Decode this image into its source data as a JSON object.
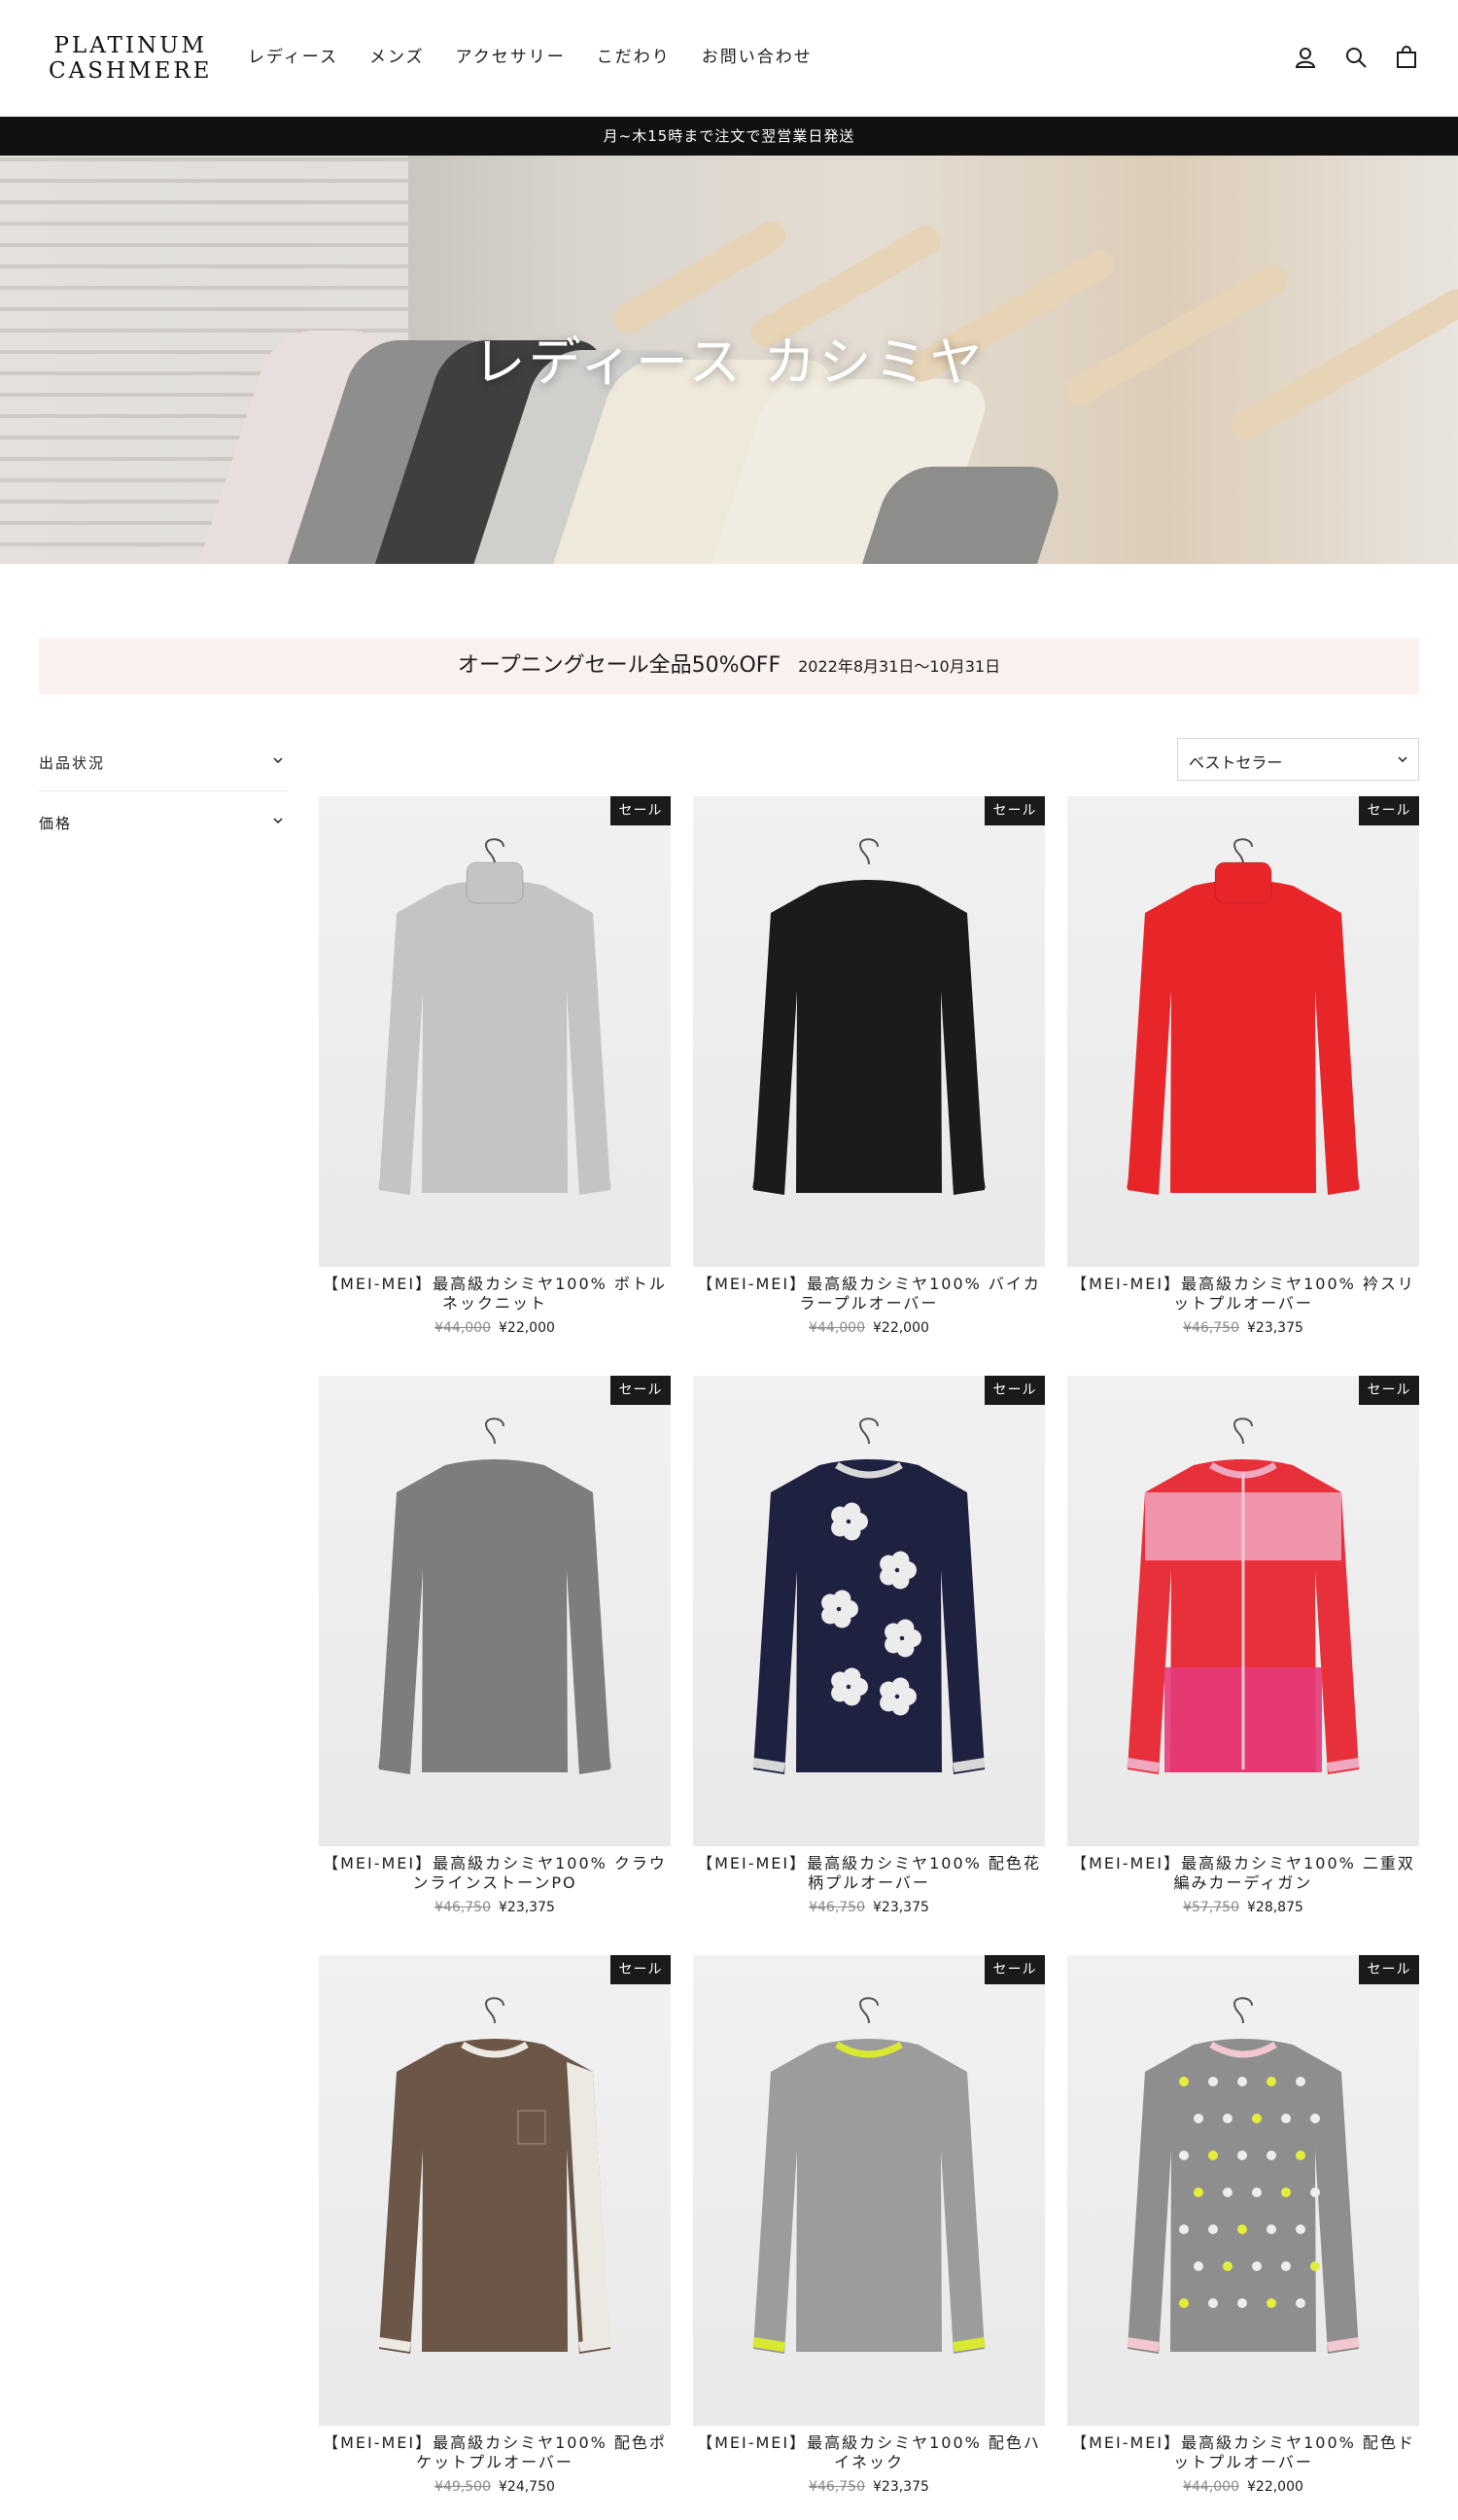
{
  "brand": {
    "line1": "PLATINUM",
    "line2": "CASHMERE"
  },
  "nav": [
    "レディース",
    "メンズ",
    "アクセサリー",
    "こだわり",
    "お問い合わせ"
  ],
  "header_icons": [
    "account-icon",
    "search-icon",
    "cart-icon"
  ],
  "announcement": "月~木15時まで注文で翌営業日発送",
  "hero": {
    "title": "レディース カシミヤ"
  },
  "sale_banner": {
    "text": "オープニングセール全品50%OFF",
    "period": "2022年8月31日〜10月31日"
  },
  "filters": [
    "出品状況",
    "価格"
  ],
  "sort": {
    "selected": "ベストセラー"
  },
  "badge_label": "セール",
  "colors": {
    "accent_dark": "#1a1a1a",
    "banner_bg": "#fbf1ef"
  },
  "products": [
    {
      "title": "【MEI-MEI】最高級カシミヤ100% ボトルネックニット",
      "was": "¥44,000",
      "now": "¥22,000",
      "garment": "#c4c4c2",
      "trim": "#c4c4c2",
      "pattern": "turtle"
    },
    {
      "title": "【MEI-MEI】最高級カシミヤ100% バイカラープルオーバー",
      "was": "¥44,000",
      "now": "¥22,000",
      "garment": "#1b1b1c",
      "trim": "#1b1b1c",
      "pattern": "plain"
    },
    {
      "title": "【MEI-MEI】最高級カシミヤ100% 衿スリットプルオーバー",
      "was": "¥46,750",
      "now": "¥23,375",
      "garment": "#e8262a",
      "trim": "#e8262a",
      "pattern": "turtle"
    },
    {
      "title": "【MEI-MEI】最高級カシミヤ100% クラウンラインストーンPO",
      "was": "¥46,750",
      "now": "¥23,375",
      "garment": "#7d7d7d",
      "trim": "#7d7d7d",
      "pattern": "plain"
    },
    {
      "title": "【MEI-MEI】最高級カシミヤ100% 配色花柄プルオーバー",
      "was": "¥46,750",
      "now": "¥23,375",
      "garment": "#1e2140",
      "trim": "#d8d8d8",
      "pattern": "flowers"
    },
    {
      "title": "【MEI-MEI】最高級カシミヤ100% 二重双編みカーディガン",
      "was": "¥57,750",
      "now": "¥28,875",
      "garment": "#e8303a",
      "trim": "#f0a8c0",
      "pattern": "stripes"
    },
    {
      "title": "【MEI-MEI】最高級カシミヤ100% 配色ポケットプルオーバー",
      "was": "¥49,500",
      "now": "¥24,750",
      "garment": "#6b5648",
      "trim": "#ece8e2",
      "pattern": "sleeve-stripe"
    },
    {
      "title": "【MEI-MEI】最高級カシミヤ100% 配色ハイネック",
      "was": "¥46,750",
      "now": "¥23,375",
      "garment": "#9c9c9c",
      "trim": "#d9e830",
      "pattern": "plain"
    },
    {
      "title": "【MEI-MEI】最高級カシミヤ100% 配色ドットプルオーバー",
      "was": "¥44,000",
      "now": "¥22,000",
      "garment": "#8e8e8e",
      "trim": "#f2c7cf",
      "pattern": "dots"
    }
  ]
}
